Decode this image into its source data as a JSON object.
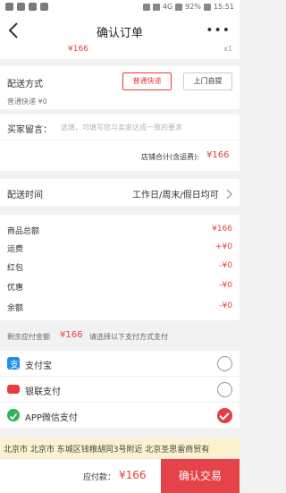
{
  "status": {
    "net_label": "4G",
    "battery": "92%",
    "time": "15:51"
  },
  "header": {
    "title": "确认订单",
    "more": "•••"
  },
  "product": {
    "price": "¥166",
    "qty": "x1"
  },
  "delivery": {
    "label": "配送方式",
    "option_express": "普通快递",
    "option_pickup": "上门自提",
    "shipping_hint": "普通快递 ¥0"
  },
  "message": {
    "label": "买家留言：",
    "placeholder": "选填，可填写您与卖家达成一致的要求"
  },
  "shop_total": {
    "label": "店铺合计(含运费):",
    "value": "¥166"
  },
  "delivery_time": {
    "label": "配送时间",
    "value": "工作日/周末/假日均可"
  },
  "summary": {
    "goods_label": "商品总额",
    "goods_value": "¥166",
    "freight_label": "运费",
    "freight_value": "+¥0",
    "redpacket_label": "红包",
    "redpacket_value": "-¥0",
    "discount_label": "优惠",
    "discount_value": "-¥0",
    "balance_label": "余额",
    "balance_value": "-¥0"
  },
  "payable": {
    "label": "剩余应付金额",
    "value": "¥166",
    "hint": "请选择以下支付方式支付"
  },
  "payments": [
    {
      "name": "支付宝",
      "icon": "alipay-icon",
      "color": "#1a8ff0",
      "selected": false
    },
    {
      "name": "银联支付",
      "icon": "unionpay-icon",
      "color": "#e63d3d",
      "selected": false
    },
    {
      "name": "APP微信支付",
      "icon": "wechat-icon",
      "color": "#31b256",
      "selected": true
    }
  ],
  "address": "北京市 北京市 东城区钱粮胡同3号附近 北京圣思雷商贸有",
  "bottom": {
    "pay_label": "应付款：",
    "pay_value": "¥166",
    "confirm_label": "确认交易"
  },
  "colors": {
    "accent": "#e63d3d"
  }
}
